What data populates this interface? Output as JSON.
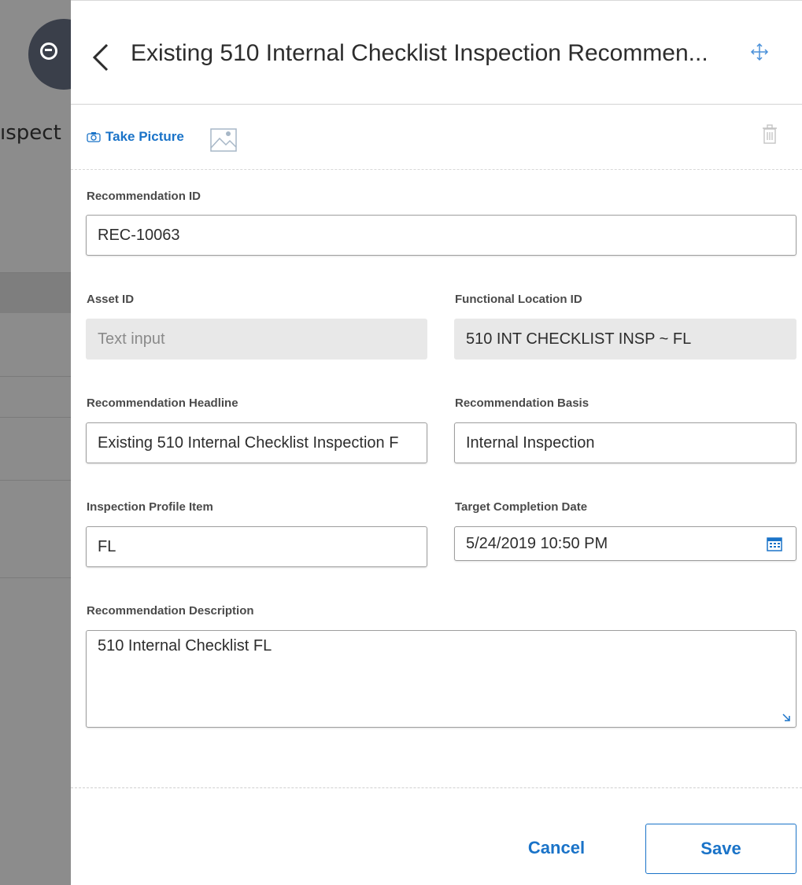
{
  "background": {
    "title_fragment": "ıspect"
  },
  "header": {
    "title": "Existing 510 Internal Checklist Inspection Recommen..."
  },
  "toolbar": {
    "take_picture_label": "Take Picture"
  },
  "form": {
    "recommendation_id": {
      "label": "Recommendation ID",
      "value": "REC-10063"
    },
    "asset_id": {
      "label": "Asset ID",
      "placeholder": "Text input"
    },
    "functional_location_id": {
      "label": "Functional Location ID",
      "value": "510 INT CHECKLIST INSP ~ FL"
    },
    "recommendation_headline": {
      "label": "Recommendation Headline",
      "value": "Existing 510 Internal Checklist Inspection F"
    },
    "recommendation_basis": {
      "label": "Recommendation Basis",
      "value": "Internal Inspection"
    },
    "inspection_profile_item": {
      "label": "Inspection Profile Item",
      "value": "FL"
    },
    "target_completion_date": {
      "label": "Target Completion Date",
      "value": "5/24/2019 10:50 PM"
    },
    "recommendation_description": {
      "label": "Recommendation Description",
      "value": "510 Internal Checklist FL"
    }
  },
  "footer": {
    "cancel_label": "Cancel",
    "save_label": "Save"
  },
  "colors": {
    "accent": "#1a73c8",
    "readonly_bg": "#e8e8e8",
    "overlay_bg": "#8a8a8a"
  },
  "icons": [
    "back-chevron-icon",
    "move-arrows-icon",
    "camera-icon",
    "image-icon",
    "trash-icon",
    "calendar-icon",
    "resize-handle-icon"
  ]
}
